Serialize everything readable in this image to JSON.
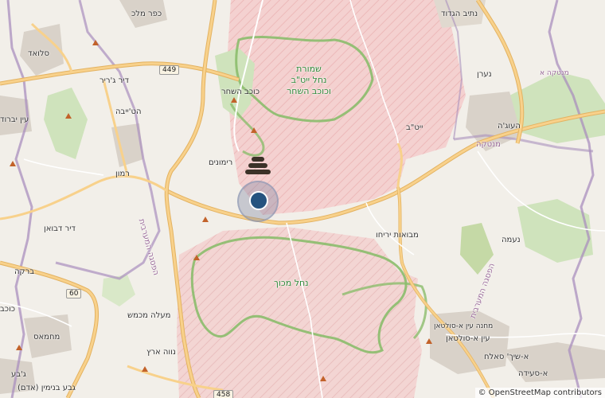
{
  "map": {
    "attribution": "© OpenStreetMap contributors",
    "colors": {
      "background": "#f2efe9",
      "reserve_fill": "#f4cccd",
      "reserve_border": "#86b368",
      "admin_border": "#a28ab5",
      "road_major": "#f8c46c",
      "road_minor": "#ffffff",
      "settlement": "#d9d2c9",
      "forest": "#add19e",
      "marker": "#25537f"
    },
    "icons": [
      "location-marker-icon",
      "stacked-layers-icon",
      "peak-icon"
    ],
    "reserves": [
      {
        "label_lines": [
          "שמורת",
          "נחל ייט\"ב",
          "וכוכב השחר"
        ]
      },
      {
        "label_lines": [
          "נחל מכוך"
        ]
      }
    ],
    "place_labels": [
      "כפר מלכ",
      "נתיב הגדוד",
      "סלואד",
      "דיר ג'ריר",
      "כוכב השחר",
      "נערן",
      "עין יברוד",
      "הט'ייבה",
      "ייט\"ב",
      "העוג'ה",
      "מנטקה",
      "רמון",
      "רימונים",
      "דיר דבואן",
      "מבואות יריחו",
      "נעמה",
      "ברקה",
      "כוכב",
      "מעלה מכמש",
      "מחמאס",
      "נווה ארץ",
      "עין א-סולטאן",
      "מחנה עין א-סולטאן",
      "א-שיך' סאלח",
      "ג'בע",
      "גבע בנימין (אדם)",
      "א-סעידה",
      "מנטקה א"
    ],
    "region_labels": [
      "הפסגה המערבית",
      "הפסגה המערבית"
    ],
    "road_shields": [
      "449",
      "60",
      "458"
    ]
  }
}
